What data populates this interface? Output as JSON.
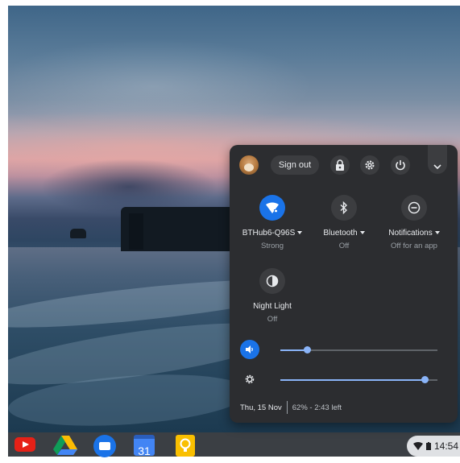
{
  "panel": {
    "sign_out_label": "Sign out",
    "header_icons": [
      "avatar",
      "lock-icon",
      "settings-icon",
      "power-icon",
      "chevron-down-icon"
    ],
    "feature_pods": [
      {
        "label": "BTHub6-Q96S",
        "sublabel": "Strong",
        "icon": "wifi-icon",
        "active": true,
        "has_menu": true
      },
      {
        "label": "Bluetooth",
        "sublabel": "Off",
        "icon": "bluetooth-icon",
        "active": false,
        "has_menu": true
      },
      {
        "label": "Notifications",
        "sublabel": "Off for an app",
        "icon": "do-not-disturb-icon",
        "active": false,
        "has_menu": true
      },
      {
        "label": "Night Light",
        "sublabel": "Off",
        "icon": "night-light-icon",
        "active": false,
        "has_menu": false
      }
    ],
    "sliders": {
      "volume": {
        "icon": "volume-icon",
        "level": 0.17
      },
      "brightness": {
        "icon": "brightness-icon",
        "level": 0.92
      }
    },
    "footer": {
      "date": "Thu, 15 Nov",
      "battery": "62% - 2:43 left"
    }
  },
  "shelf": {
    "apps": [
      "youtube-icon",
      "google-drive-icon",
      "files-icon",
      "calendar-icon",
      "keep-icon"
    ],
    "calendar_day": "31",
    "status": {
      "time": "14:54"
    }
  },
  "colors": {
    "accent": "#1a73e8",
    "panel_bg": "#2c2d30",
    "slider_active": "#8ab4f8"
  }
}
